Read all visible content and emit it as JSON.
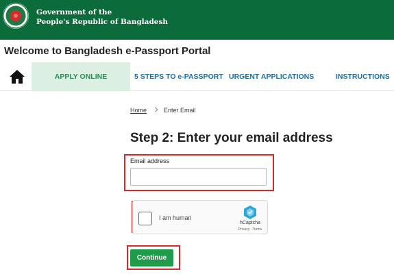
{
  "header": {
    "gov_name_line1": "Government of the",
    "gov_name_line2": "People's Republic of Bangladesh",
    "brand_color": "#0b6b3a"
  },
  "portal_title": "Welcome to Bangladesh e-Passport Portal",
  "nav": {
    "home_icon": "home-icon",
    "items": [
      {
        "label": "APPLY ONLINE",
        "active": true
      },
      {
        "label": "5 STEPS TO e-PASSPORT",
        "active": false
      },
      {
        "label": "URGENT APPLICATIONS",
        "active": false
      },
      {
        "label": "INSTRUCTIONS",
        "active": false
      }
    ],
    "active_bg": "#dbefe2",
    "link_color": "#1b6ea8"
  },
  "breadcrumb": {
    "home": "Home",
    "separator_icon": "chevron-right-icon",
    "current": "Enter Email"
  },
  "form": {
    "title": "Step 2: Enter your email address",
    "email_label": "Email address",
    "email_value": "",
    "email_placeholder": ""
  },
  "captcha": {
    "label": "I am human",
    "brand": "hCaptcha",
    "links": "Privacy - Terms",
    "checked": false
  },
  "continue_label": "Continue",
  "continue_color": "#1f9b4c",
  "highlight_color": "#d42a2a"
}
